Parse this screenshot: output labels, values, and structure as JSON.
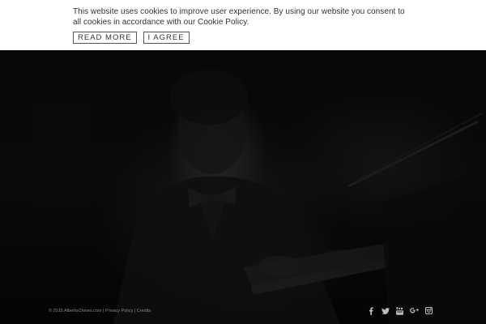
{
  "cookie_banner": {
    "message": "This website uses cookies to improve user experience. By using our website you consent to all cookies in accordance with our Cookie Policy.",
    "read_more_label": "READ MORE",
    "agree_label": "I AGREE"
  },
  "footer": {
    "copyright": "© 2015 AlbertoChines.com",
    "separator": "|",
    "privacy_label": "Privacy Policy",
    "credits_label": "Credits"
  },
  "social": [
    {
      "icon": "facebook-icon"
    },
    {
      "icon": "twitter-icon"
    },
    {
      "icon": "youtube-icon"
    },
    {
      "icon": "google-plus-icon"
    },
    {
      "icon": "instagram-icon"
    }
  ],
  "colors": {
    "banner_bg": "#ffffff",
    "banner_text": "#333333",
    "page_bg": "#050505",
    "footer_text": "#888888",
    "social_icons": "#bbbbbb"
  }
}
